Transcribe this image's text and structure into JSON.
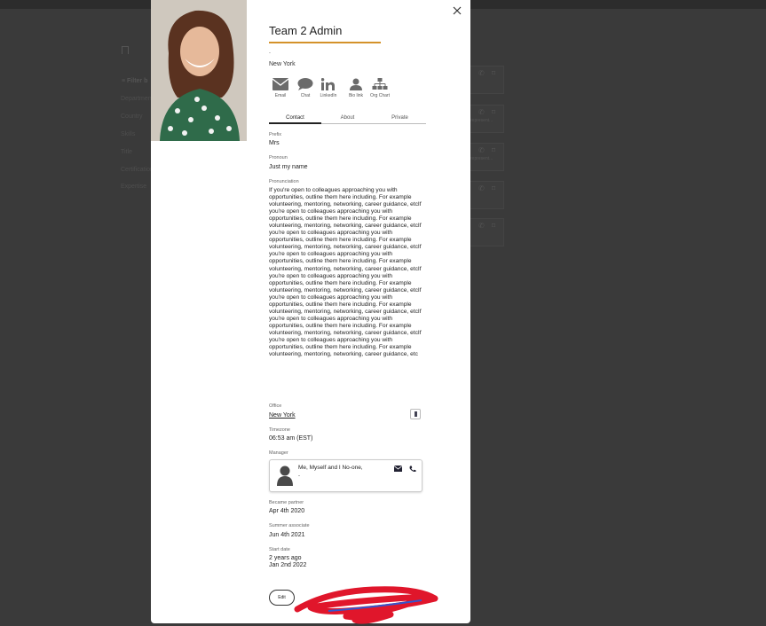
{
  "background": {
    "filter_title": "≡ Filter b",
    "filter_items": [
      "Department",
      "Country",
      "Skills",
      "Title",
      "Certification",
      "Expertise"
    ],
    "card_snippet": "represent..."
  },
  "profile": {
    "name": "Team 2 Admin",
    "subtitle": ".",
    "location": "New York",
    "photo_alt": "profile-photo"
  },
  "actions": [
    {
      "label": "Email",
      "icon": "email-icon"
    },
    {
      "label": "Chat",
      "icon": "chat-icon"
    },
    {
      "label": "LinkedIn",
      "icon": "linkedin-icon"
    },
    {
      "label": "Bio link",
      "icon": "bio-link-icon"
    },
    {
      "label": "Org Chart",
      "icon": "org-chart-icon"
    }
  ],
  "tabs": [
    "Contact",
    "About",
    "Private"
  ],
  "active_tab": "Contact",
  "fields": {
    "prefix_label": "Prefix",
    "prefix_value": "Mrs",
    "pronoun_label": "Pronoun",
    "pronoun_value": "Just my name",
    "pronunciation_label": "Pronunciation",
    "pronunciation_value": "If you're open to colleagues approaching you with opportunities, outline them here including. For example volunteering, mentoring, networking, career guidance, etcIf you're open to colleagues approaching you with opportunities, outline them here including. For example volunteering, mentoring, networking, career guidance, etcIf you're open to colleagues approaching you with opportunities, outline them here including. For example volunteering, mentoring, networking, career guidance, etcIf you're open to colleagues approaching you with opportunities, outline them here including. For example volunteering, mentoring, networking, career guidance, etcIf you're open to colleagues approaching you with opportunities, outline them here including. For example volunteering, mentoring, networking, career guidance, etcIf you're open to colleagues approaching you with opportunities, outline them here including. For example volunteering, mentoring, networking, career guidance, etcIf you're open to colleagues approaching you with opportunities, outline them here including. For example volunteering, mentoring, networking, career guidance, etcIf you're open to colleagues approaching you with opportunities, outline them here including. For example volunteering, mentoring, networking, career guidance, etc",
    "office_label": "Office",
    "office_value": "New York",
    "timezone_label": "Timezone",
    "timezone_value": "06:53 am (EST)",
    "manager_label": "Manager",
    "manager_name": "Me, Myself and I No-one,",
    "manager_sub": "-",
    "became_partner_label": "Became partner",
    "became_partner_value": "Apr 4th 2020",
    "summer_associate_label": "Summer associate",
    "summer_associate_value": "Jun 4th 2021",
    "start_date_label": "Start date",
    "start_date_relative": "2 years ago",
    "start_date_value": "Jan 2nd 2022"
  },
  "edit_label": "Edit",
  "colors": {
    "accent_underline": "#d4922a",
    "icon_gray": "#6b6b6b",
    "scribble_red": "#e0162b",
    "scribble_blue": "#3355cc"
  }
}
